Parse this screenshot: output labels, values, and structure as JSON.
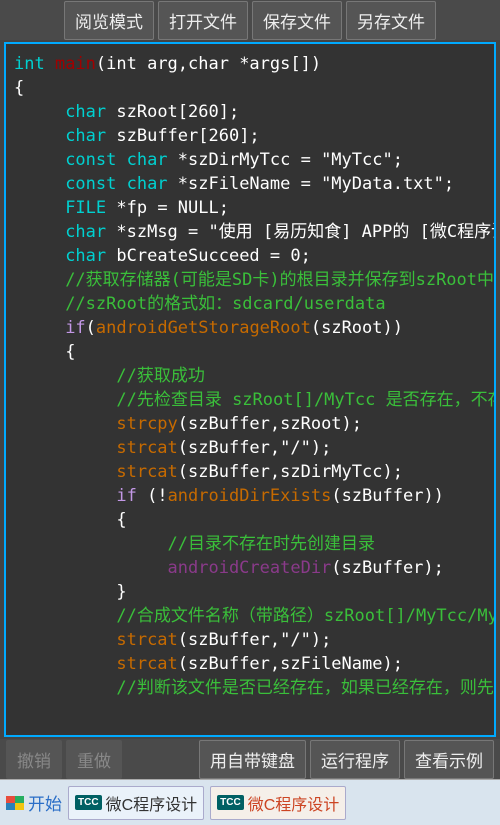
{
  "toolbar": {
    "view_mode": "阅览模式",
    "open_file": "打开文件",
    "save_file": "保存文件",
    "save_as": "另存文件"
  },
  "code": {
    "l01_kw": "int ",
    "l01_fn": "main",
    "l01_rest": "(int arg,char *args[])",
    "l02": "{",
    "l03_kw": "char",
    "l03_rest": " szRoot[260];",
    "l04_kw": "char",
    "l04_rest": " szBuffer[260];",
    "l05_kw": "const char",
    "l05_rest": " *szDirMyTcc = \"MyTcc\";",
    "l06_kw": "const char",
    "l06_rest": " *szFileName = \"MyData.txt\";",
    "l07_kw": "FILE",
    "l07_rest": " *fp = NULL;",
    "l08_kw": "char",
    "l08_rest": " *szMsg = \"使用  [易历知食]  APP的  [微C程序设计",
    "l09_kw": "char",
    "l09_rest": " bCreateSucceed = 0;",
    "l10": "//获取存储器(可能是SD卡)的根目录并保存到szRoot中",
    "l11": "//szRoot的格式如：sdcard/userdata",
    "l12_if": "if",
    "l12_lp": "(",
    "l12_fn": "androidGetStorageRoot",
    "l12_rp": "(szRoot))",
    "l13": "{",
    "l14": "//获取成功",
    "l15": "//先检查目录 szRoot[]/MyTcc 是否存在，不存在贝",
    "l16_fn": "strcpy",
    "l16_rest": "(szBuffer,szRoot);",
    "l17_fn": "strcat",
    "l17_rest": "(szBuffer,\"/\");",
    "l18_fn": "strcat",
    "l18_rest": "(szBuffer,szDirMyTcc);",
    "l19_if": "if",
    "l19_a": " (!",
    "l19_fn": "androidDirExists",
    "l19_b": "(szBuffer))",
    "l20": "{",
    "l21": "//目录不存在时先创建目录",
    "l22_fn": "androidCreateDir",
    "l22_rest": "(szBuffer);",
    "l23": "}",
    "l24": "//合成文件名称（带路径）szRoot[]/MyTcc/MyDa",
    "l25_fn": "strcat",
    "l25_rest": "(szBuffer,\"/\");",
    "l26_fn": "strcat",
    "l26_rest": "(szBuffer,szFileName);",
    "l27": "//判断该文件是否已经存在，如果已经存在，则先"
  },
  "bottom": {
    "undo": "撤销",
    "redo": "重做",
    "keyboard": "用自带键盘",
    "run": "运行程序",
    "examples": "查看示例"
  },
  "taskbar": {
    "start": "开始",
    "tcc_badge": "TCC",
    "item1": "微C程序设计",
    "item2": "微C程序设计"
  }
}
